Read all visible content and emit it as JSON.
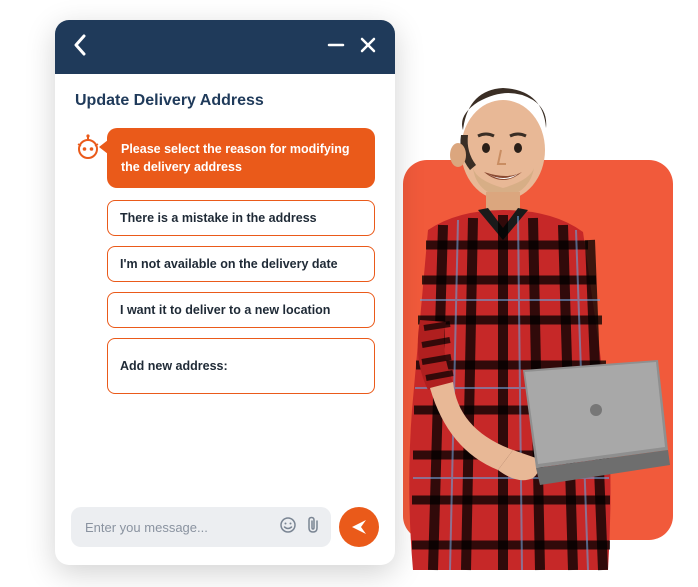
{
  "colors": {
    "header": "#1f3a5a",
    "accent": "#ea5a1a",
    "bg_square": "#f15a3b"
  },
  "chat": {
    "title": "Update Delivery Address",
    "bot_message": "Please select the reason for modifying the delivery address",
    "options": [
      "There is a mistake in the address",
      "I'm not available on the delivery date",
      "I want it to deliver to a new location",
      "Add new address:"
    ],
    "input_placeholder": "Enter you message..."
  }
}
